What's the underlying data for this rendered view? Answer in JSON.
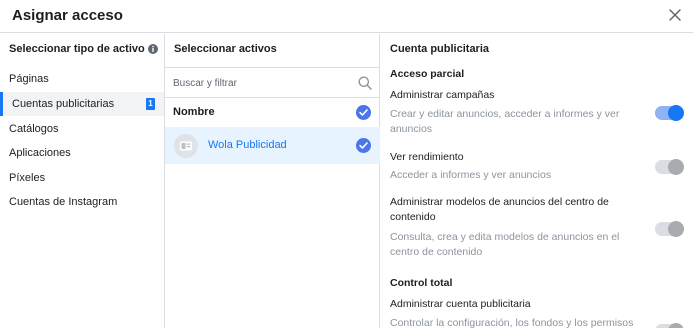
{
  "dialog": {
    "title": "Asignar acceso"
  },
  "asset_types": {
    "title": "Seleccionar tipo de activo",
    "items": [
      {
        "label": "Páginas"
      },
      {
        "label": "Cuentas publicitarias",
        "count": "1"
      },
      {
        "label": "Catálogos"
      },
      {
        "label": "Aplicaciones"
      },
      {
        "label": "Píxeles"
      },
      {
        "label": "Cuentas de Instagram"
      }
    ]
  },
  "assets": {
    "title": "Seleccionar activos",
    "search": {
      "placeholder": "Buscar y filtrar",
      "value": ""
    },
    "column_header": "Nombre",
    "items": [
      {
        "name": "Wola Publicidad",
        "checked": true
      }
    ]
  },
  "permissions": {
    "title": "Cuenta publicitaria",
    "partial": {
      "title": "Acceso parcial",
      "items": [
        {
          "title": "Administrar campañas",
          "description": "Crear y editar anuncios, acceder a informes y ver anuncios",
          "enabled": true
        },
        {
          "title": "Ver rendimiento",
          "description": "Acceder a informes y ver anuncios",
          "enabled": false
        },
        {
          "title": "Administrar modelos de anuncios del centro de contenido",
          "description": "Consulta, crea y edita modelos de anuncios en el centro de contenido",
          "enabled": false
        }
      ]
    },
    "full": {
      "title": "Control total",
      "items": [
        {
          "title": "Administrar cuenta publicitaria",
          "description": "Controlar la configuración, los fondos y los permisos"
        }
      ]
    }
  },
  "colors": {
    "accent": "#1877f2",
    "selected_row": "#e7f3ff",
    "muted_text": "#8d949e"
  }
}
